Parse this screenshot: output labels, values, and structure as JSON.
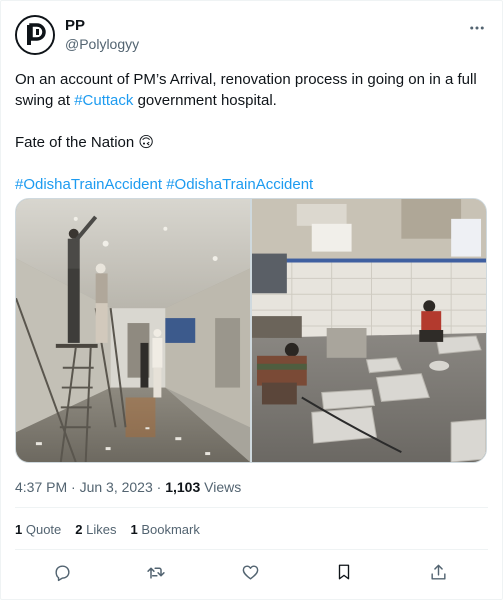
{
  "tweet": {
    "author": {
      "name": "PP",
      "handle": "@Polylogyy"
    },
    "text": {
      "line1_before_link": "On an account of PM’s Arrival, renovation process in going on in a full swing at ",
      "line1_link": "#Cuttack",
      "line1_after_link": " government hospital.",
      "line2": "Fate of the Nation 🙃",
      "hashtag1": "#OdishaTrainAccident",
      "hashtag2": "#OdishaTrainAccident"
    },
    "timestamp": "4:37 PM · Jun 3, 2023 · ",
    "views_count": "1,103",
    "views_label": " Views",
    "stats": {
      "quotes_count": "1",
      "quotes_label": " Quote",
      "likes_count": "2",
      "likes_label": " Likes",
      "bookmarks_count": "1",
      "bookmarks_label": " Bookmark"
    }
  },
  "icons": {
    "more": "more-horizontal-icon",
    "reply": "reply-icon",
    "retweet": "retweet-icon",
    "like": "heart-icon",
    "bookmark": "bookmark-icon",
    "share": "share-icon"
  },
  "colors": {
    "text": "#0f1419",
    "secondary": "#536471",
    "link": "#1d9bf0",
    "divider": "#eff3f4"
  }
}
